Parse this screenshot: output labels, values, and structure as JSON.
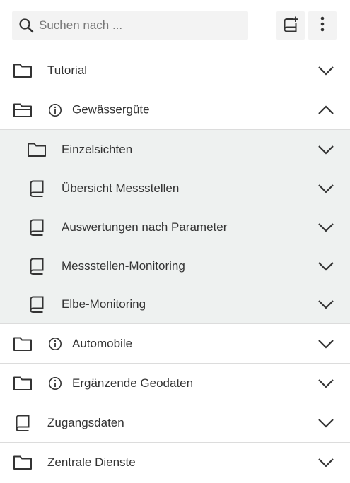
{
  "search": {
    "placeholder": "Suchen nach ..."
  },
  "toolbar": {
    "add_icon": "add-book-icon",
    "more_icon": "more-vertical-icon"
  },
  "tree": {
    "items": [
      {
        "label": "Tutorial",
        "icon": "folder-icon",
        "info": false,
        "expanded": false
      },
      {
        "label": "Gewässergüte",
        "icon": "folder-open-icon",
        "info": true,
        "expanded": true,
        "children": [
          {
            "label": "Einzelsichten",
            "icon": "folder-icon"
          },
          {
            "label": "Übersicht Messstellen",
            "icon": "book-icon"
          },
          {
            "label": "Auswertungen nach Parameter",
            "icon": "book-icon"
          },
          {
            "label": "Messstellen-Monitoring",
            "icon": "book-icon"
          },
          {
            "label": "Elbe-Monitoring",
            "icon": "book-icon"
          }
        ]
      },
      {
        "label": "Automobile",
        "icon": "folder-icon",
        "info": true,
        "expanded": false
      },
      {
        "label": "Ergänzende Geodaten",
        "icon": "folder-icon",
        "info": true,
        "expanded": false
      },
      {
        "label": "Zugangsdaten",
        "icon": "book-icon",
        "info": false,
        "expanded": false
      },
      {
        "label": "Zentrale Dienste",
        "icon": "folder-icon",
        "info": false,
        "expanded": false
      }
    ]
  },
  "colors": {
    "child_background": "#eef1f0",
    "toolbar_background": "#f3f3f3",
    "divider": "#dcdcdc",
    "icon": "#333333"
  }
}
